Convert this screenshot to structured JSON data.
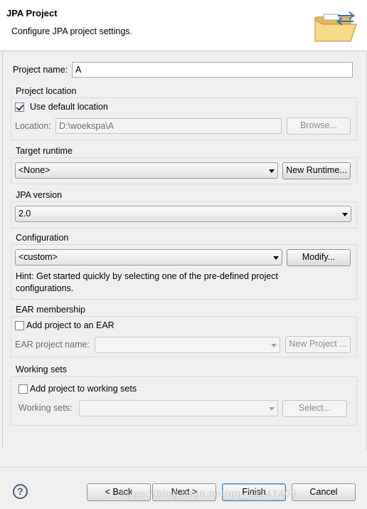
{
  "header": {
    "title": "JPA Project",
    "description": "Configure JPA project settings.",
    "banner_icon": "folder-jpa-icon"
  },
  "project_name": {
    "label": "Project name:",
    "value": "A"
  },
  "project_location": {
    "group_label": "Project location",
    "use_default_label": "Use default location",
    "use_default_checked": true,
    "location_label": "Location:",
    "location_value": "D:\\woekspa\\A",
    "browse_label": "Browse..."
  },
  "target_runtime": {
    "group_label": "Target runtime",
    "selected": "<None>",
    "new_runtime_label": "New Runtime..."
  },
  "jpa_version": {
    "group_label": "JPA version",
    "selected": "2.0"
  },
  "configuration": {
    "group_label": "Configuration",
    "selected": "<custom>",
    "modify_label": "Modify...",
    "hint": "Hint: Get started quickly by selecting one of the pre-defined project configurations."
  },
  "ear": {
    "group_label": "EAR membership",
    "add_label": "Add project to an EAR",
    "add_checked": false,
    "project_name_label": "EAR project name:",
    "project_name_value": "",
    "new_project_label": "New Project ..."
  },
  "working_sets": {
    "group_label": "Working sets",
    "add_label": "Add project to working sets",
    "add_checked": false,
    "sets_label": "Working sets:",
    "sets_value": "",
    "select_label": "Select..."
  },
  "footer": {
    "help_icon": "help-question-icon",
    "back_label": "< Back",
    "next_label": "Next >",
    "finish_label": "Finish",
    "cancel_label": "Cancel",
    "watermark": "https://blog.csdn.net/qq_28241405"
  }
}
